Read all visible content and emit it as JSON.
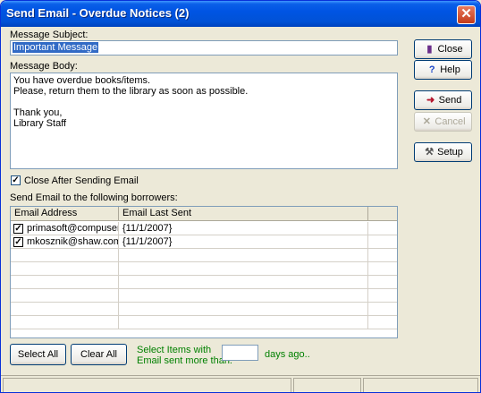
{
  "window": {
    "title": "Send Email - Overdue Notices (2)",
    "close_glyph": "✕"
  },
  "subject": {
    "label": "Message Subject:",
    "value": "Important Message"
  },
  "body": {
    "label": "Message Body:",
    "value": "You have overdue books/items.\nPlease, return them to the library as soon as possible.\n\nThank you,\nLibrary Staff"
  },
  "options": {
    "close_after_label": "Close After Sending Email",
    "close_after_checked": true
  },
  "borrowers": {
    "label": "Send Email to the following borrowers:",
    "columns": [
      "Email Address",
      "Email Last Sent"
    ],
    "rows": [
      {
        "email": "primasoft@compuserv...",
        "last_sent": "{11/1/2007}",
        "checked": true
      },
      {
        "email": "mkosznik@shaw.com",
        "last_sent": "{11/1/2007}",
        "checked": true
      }
    ]
  },
  "buttons": {
    "close": "Close",
    "help": "Help",
    "send": "Send",
    "cancel": "Cancel",
    "setup": "Setup",
    "select_all": "Select All",
    "clear_all": "Clear All"
  },
  "icons": {
    "close": "door-icon",
    "help": "question-icon",
    "send": "arrow-icon",
    "cancel": "x-icon",
    "setup": "tools-icon"
  },
  "filter": {
    "line1": "Select Items with",
    "line2": "Email sent more than:",
    "value": "",
    "suffix": "days ago.."
  },
  "colors": {
    "title_bar": "#0054e3",
    "green_text": "#008000",
    "selection": "#316ac5"
  }
}
